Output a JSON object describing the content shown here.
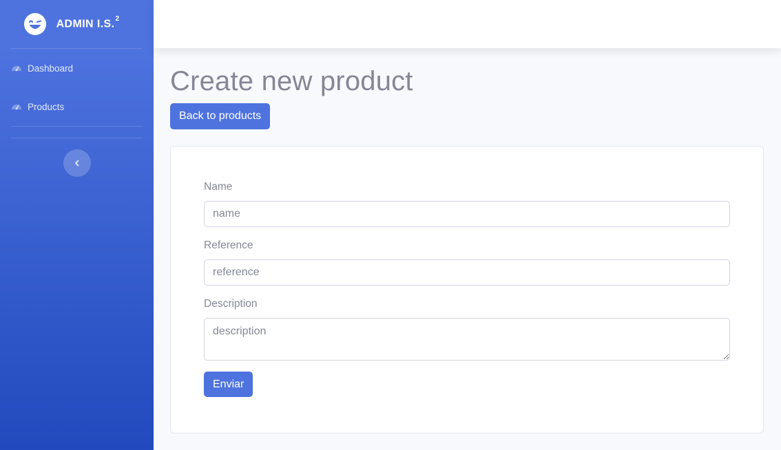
{
  "sidebar": {
    "brand": {
      "text": "ADMIN I.S.",
      "sup": "2",
      "icon": "laugh-wink-icon"
    },
    "items": [
      {
        "label": "Dashboard",
        "icon": "tachometer-icon"
      },
      {
        "label": "Products",
        "icon": "tachometer-icon"
      }
    ],
    "toggle_icon": "chevron-left-icon"
  },
  "main": {
    "title": "Create new product",
    "back_button": "Back to products",
    "form": {
      "fields": [
        {
          "label": "Name",
          "placeholder": "name",
          "value": ""
        },
        {
          "label": "Reference",
          "placeholder": "reference",
          "value": ""
        },
        {
          "label": "Description",
          "placeholder": "description",
          "value": ""
        }
      ],
      "submit_label": "Enviar"
    }
  },
  "colors": {
    "primary": "#4e73df",
    "sidebar_gradient_end": "#224abe",
    "text_muted": "#858796",
    "background": "#f8f9fc"
  }
}
